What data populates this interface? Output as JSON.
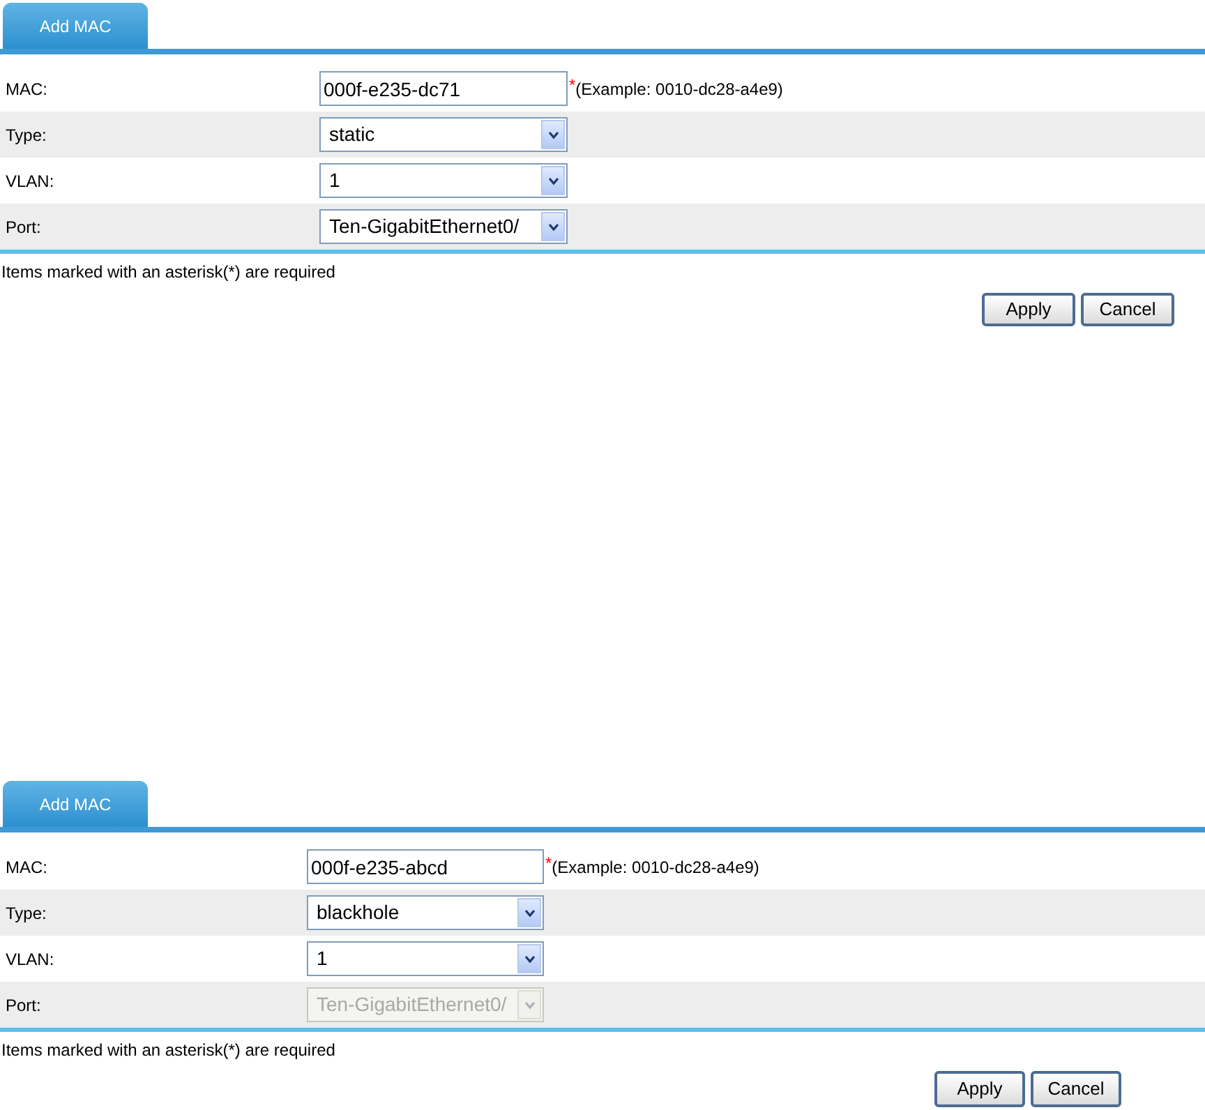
{
  "panels": [
    {
      "tab": {
        "label": "Add MAC",
        "selected": true
      },
      "fields": [
        {
          "kind": "text",
          "label": "MAC:",
          "value": "000f-e235-dc71",
          "required_mark": "*",
          "hint": "(Example: 0010-dc28-a4e9)"
        },
        {
          "kind": "select",
          "label": "Type:",
          "value": "static",
          "disabled": false
        },
        {
          "kind": "select",
          "label": "VLAN:",
          "value": "1",
          "disabled": false
        },
        {
          "kind": "select",
          "label": "Port:",
          "value": "Ten-GigabitEthernet0/",
          "disabled": false
        }
      ],
      "note": "Items marked with an asterisk(*) are required",
      "buttons": [
        "Apply",
        "Cancel"
      ]
    },
    {
      "tab": {
        "label": "Add MAC",
        "selected": true
      },
      "fields": [
        {
          "kind": "text",
          "label": "MAC:",
          "value": "000f-e235-abcd",
          "required_mark": "*",
          "hint": "(Example: 0010-dc28-a4e9)"
        },
        {
          "kind": "select",
          "label": "Type:",
          "value": "blackhole",
          "disabled": false
        },
        {
          "kind": "select",
          "label": "VLAN:",
          "value": "1",
          "disabled": false
        },
        {
          "kind": "select",
          "label": "Port:",
          "value": "Ten-GigabitEthernet0/",
          "disabled": true
        }
      ],
      "note": "Items marked with an asterisk(*) are required",
      "buttons": [
        "Apply",
        "Cancel"
      ]
    }
  ]
}
